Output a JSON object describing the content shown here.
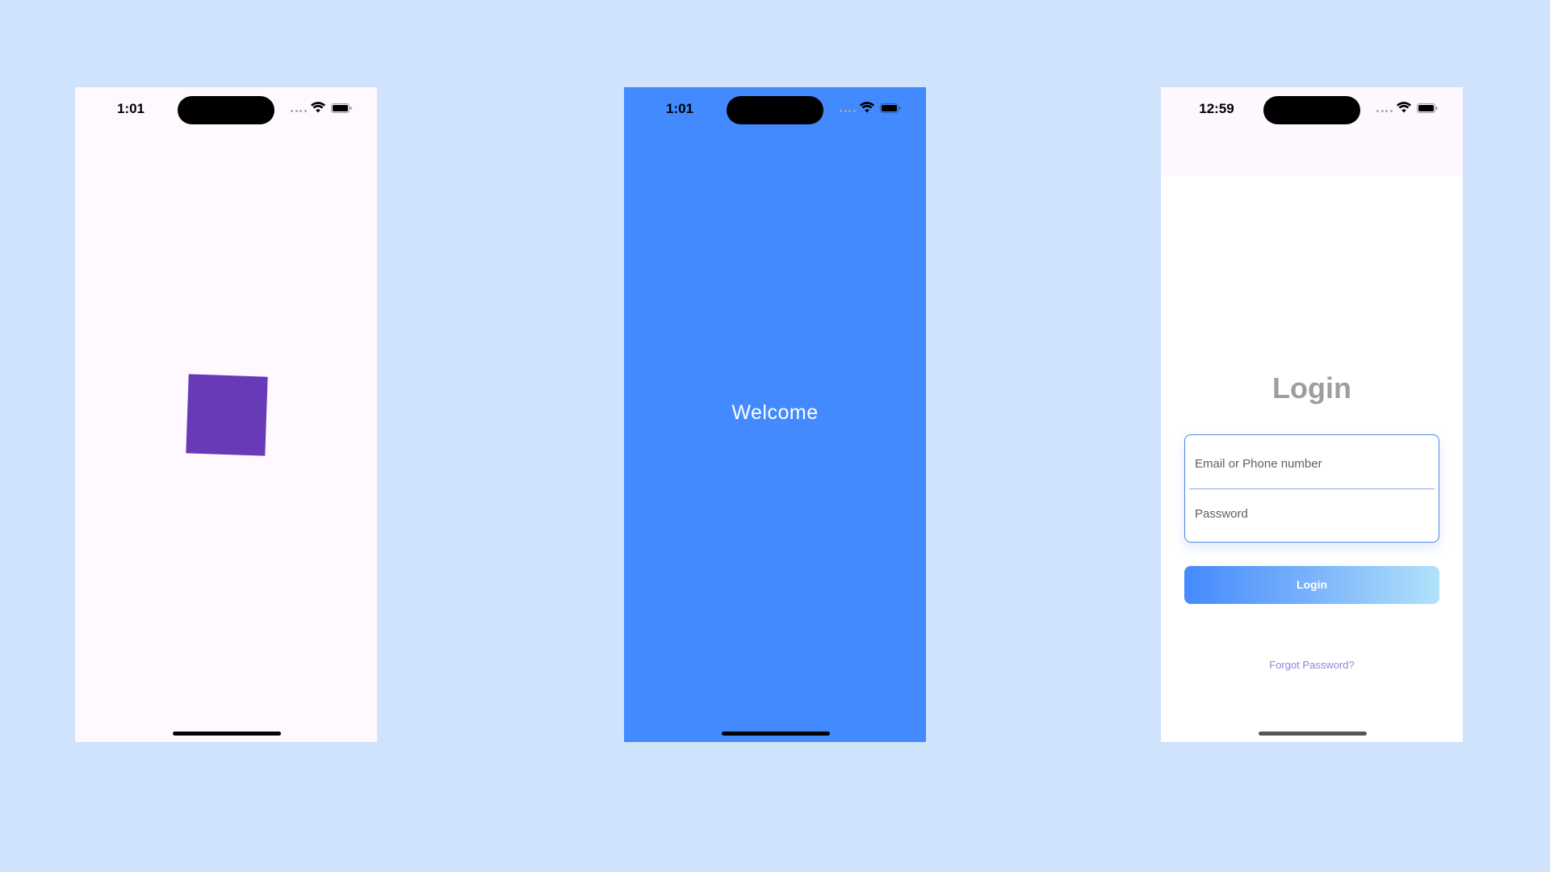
{
  "colors": {
    "background": "#cfe3fc",
    "phone1_background": "#fff8fe",
    "square": "#673ab7",
    "phone2_background": "#428afe",
    "login_title": "#9e9e9e",
    "field_border": "#4f86e8",
    "button_gradient_start": "#448afe",
    "button_gradient_end": "#b2e2fb",
    "forgot_link": "#8c85d6"
  },
  "screens": [
    {
      "status_time": "1:01",
      "icons": [
        "signal-dots-icon",
        "wifi-icon",
        "battery-icon"
      ]
    },
    {
      "status_time": "1:01",
      "welcome_text": "Welcome",
      "icons": [
        "signal-dots-icon",
        "wifi-icon",
        "battery-icon"
      ]
    },
    {
      "status_time": "12:59",
      "title": "Login",
      "email_placeholder": "Email or Phone number",
      "password_placeholder": "Password",
      "login_button": "Login",
      "forgot_password": "Forgot Password?",
      "icons": [
        "signal-dots-icon",
        "wifi-icon",
        "battery-icon"
      ]
    }
  ]
}
